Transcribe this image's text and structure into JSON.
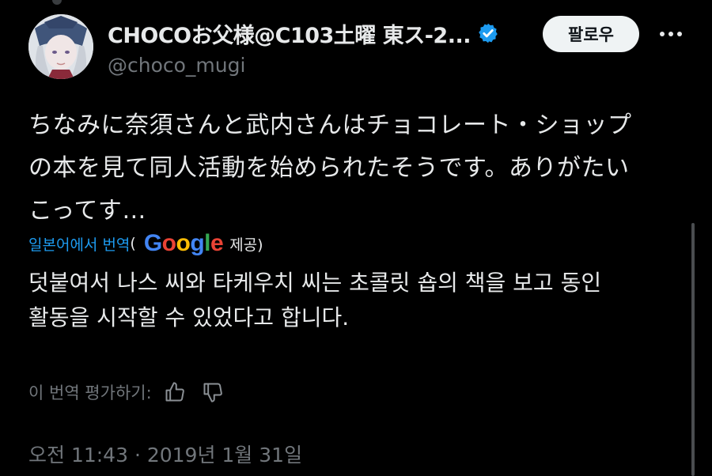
{
  "author": {
    "display_name": "CHOCOお父様@C103土曜 東ス-2...",
    "handle": "@choco_mugi"
  },
  "actions": {
    "follow_label": "팔로우"
  },
  "tweet": {
    "lines": [
      "ちなみに奈須さんと武内さんはチョコレート・ショップ",
      "の本を見て同人活動を始められたそうです。ありがたい",
      "こってす…"
    ]
  },
  "translation": {
    "link_label": "일본어에서 번역",
    "open_paren": "(",
    "provider": "Google",
    "provided_label": "제공)",
    "lines": [
      "덧붙여서 나스 씨와 타케우치 씨는 초콜릿 숍의 책을 보고 동인",
      "활동을 시작할 수 있었다고 합니다."
    ],
    "rate_label": "이 번역 평가하기:"
  },
  "meta": {
    "timestamp": "오전 11:43 · 2019년 1월 31일"
  },
  "colors": {
    "background": "#000000",
    "text": "#e7e9ea",
    "secondary": "#71767b",
    "accent": "#1d9bf0"
  },
  "icons": {
    "verified": "verified-badge-icon",
    "more": "more-icon",
    "thumbs_up": "thumbs-up-icon",
    "thumbs_down": "thumbs-down-icon"
  }
}
